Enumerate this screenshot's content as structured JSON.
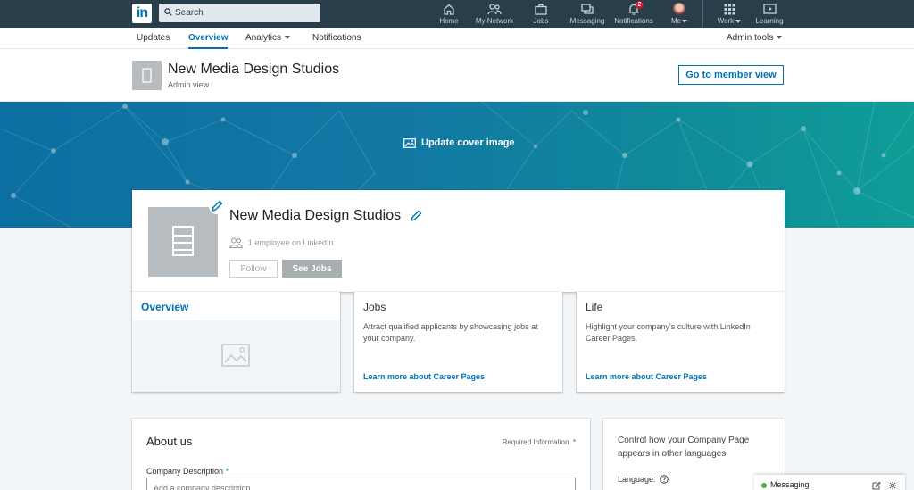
{
  "topnav": {
    "logo": "in",
    "search_placeholder": "Search",
    "items": [
      {
        "label": "Home",
        "icon": "home-icon"
      },
      {
        "label": "My Network",
        "icon": "network-icon"
      },
      {
        "label": "Jobs",
        "icon": "briefcase-icon"
      },
      {
        "label": "Messaging",
        "icon": "messaging-icon"
      },
      {
        "label": "Notifications",
        "icon": "bell-icon",
        "badge": "2"
      },
      {
        "label": "Me",
        "icon": "avatar"
      },
      {
        "label": "Work",
        "icon": "grid-icon"
      },
      {
        "label": "Learning",
        "icon": "learning-icon"
      }
    ]
  },
  "subnav": {
    "tabs": [
      {
        "label": "Updates"
      },
      {
        "label": "Overview",
        "active": true
      },
      {
        "label": "Analytics"
      },
      {
        "label": "Notifications"
      }
    ],
    "admin_tools": "Admin tools"
  },
  "admin_header": {
    "company_name": "New Media Design Studios",
    "subtitle": "Admin view",
    "member_view_button": "Go to member view"
  },
  "cover": {
    "update_label": "Update cover image"
  },
  "profile": {
    "company_name": "New Media Design Studios",
    "employees": "1 employee on LinkedIn",
    "follow_button": "Follow",
    "jobs_button": "See Jobs"
  },
  "cards": {
    "overview": {
      "title": "Overview"
    },
    "jobs": {
      "title": "Jobs",
      "description": "Attract qualified applicants by showcasing jobs at your company.",
      "link": "Learn more about Career Pages"
    },
    "life": {
      "title": "Life",
      "description": "Highlight your company's culture with LinkedIn Career Pages.",
      "link": "Learn more about Career Pages"
    }
  },
  "about": {
    "title": "About us",
    "required_info": "Required Information",
    "required_mark": "*",
    "description_label": "Company Description",
    "description_placeholder": "Add a company description"
  },
  "language": {
    "description": "Control how your Company Page appears in other languages.",
    "label": "Language:"
  },
  "messaging": {
    "label": "Messaging"
  },
  "colors": {
    "nav_bg": "#283e4a",
    "accent": "#0073b1",
    "cover_start": "#0c6fa1",
    "cover_end": "#0f9d97",
    "online": "#5ba93a",
    "badge": "#d11124"
  }
}
